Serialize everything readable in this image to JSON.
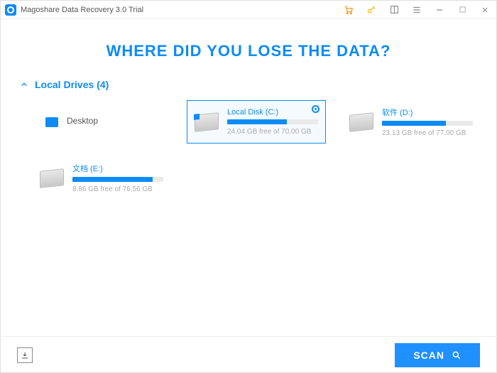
{
  "titlebar": {
    "title": "Magoshare Data Recovery 3.0 Trial"
  },
  "heading": "WHERE DID YOU LOSE THE DATA?",
  "section": {
    "label": "Local Drives (4)"
  },
  "drives": [
    {
      "name": "Desktop",
      "sub": "",
      "fill_pct": 0,
      "type": "desktop",
      "selected": false
    },
    {
      "name": "Local Disk (C:)",
      "sub": "24.04 GB free of 70.00 GB",
      "fill_pct": 66,
      "type": "hdd-win",
      "selected": true
    },
    {
      "name": "软件 (D:)",
      "sub": "23.13 GB free of 77.00 GB",
      "fill_pct": 70,
      "type": "hdd",
      "selected": false
    },
    {
      "name": "文档 (E:)",
      "sub": "8.86 GB free of 76.56 GB",
      "fill_pct": 88,
      "type": "hdd",
      "selected": false
    }
  ],
  "footer": {
    "scan_label": "SCAN"
  }
}
